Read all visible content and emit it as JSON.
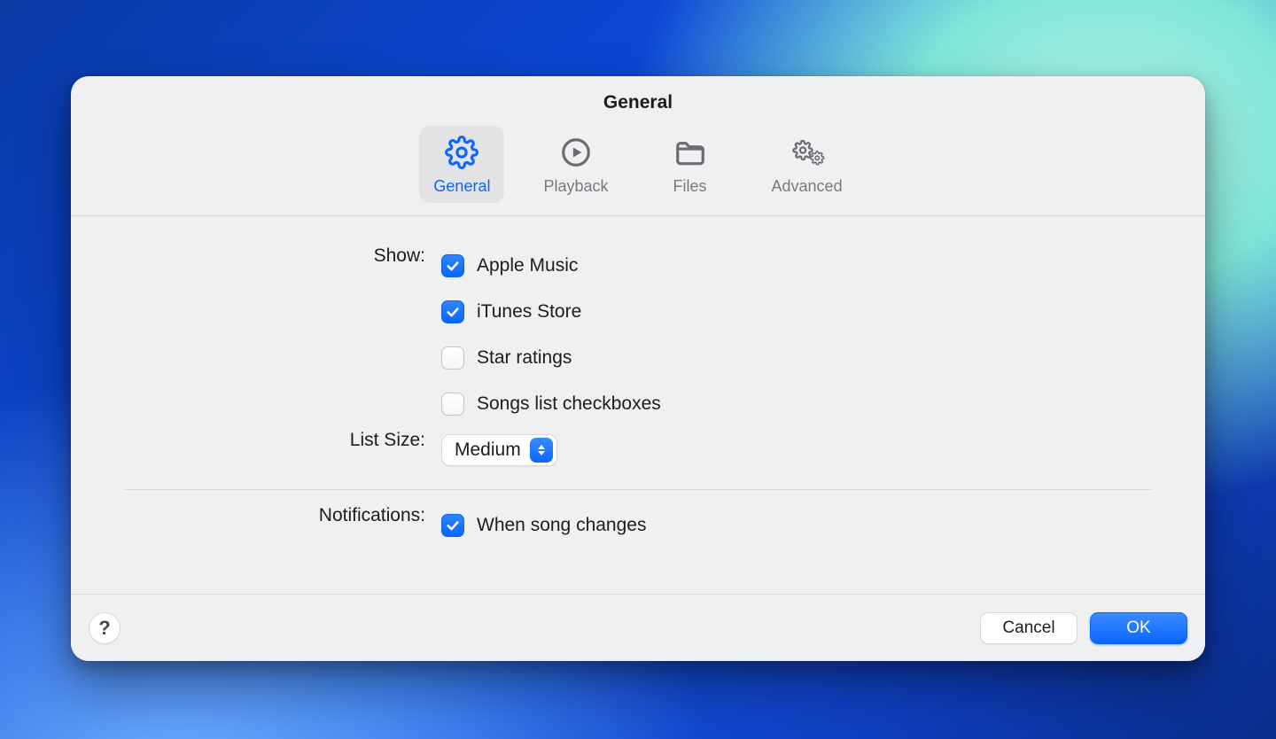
{
  "window": {
    "title": "General"
  },
  "tabs": {
    "general": {
      "label": "General"
    },
    "playback": {
      "label": "Playback"
    },
    "files": {
      "label": "Files"
    },
    "advanced": {
      "label": "Advanced"
    }
  },
  "labels": {
    "show": "Show:",
    "list_size": "List Size:",
    "notifications": "Notifications:"
  },
  "show": {
    "apple_music": {
      "label": "Apple Music",
      "checked": true
    },
    "itunes_store": {
      "label": "iTunes Store",
      "checked": true
    },
    "star_ratings": {
      "label": "Star ratings",
      "checked": false
    },
    "songs_list_checkboxes": {
      "label": "Songs list checkboxes",
      "checked": false
    }
  },
  "list_size": {
    "value": "Medium"
  },
  "notifications": {
    "when_song_changes": {
      "label": "When song changes",
      "checked": true
    }
  },
  "footer": {
    "help": "?",
    "cancel": "Cancel",
    "ok": "OK"
  },
  "colors": {
    "accent": "#0a66ff"
  }
}
